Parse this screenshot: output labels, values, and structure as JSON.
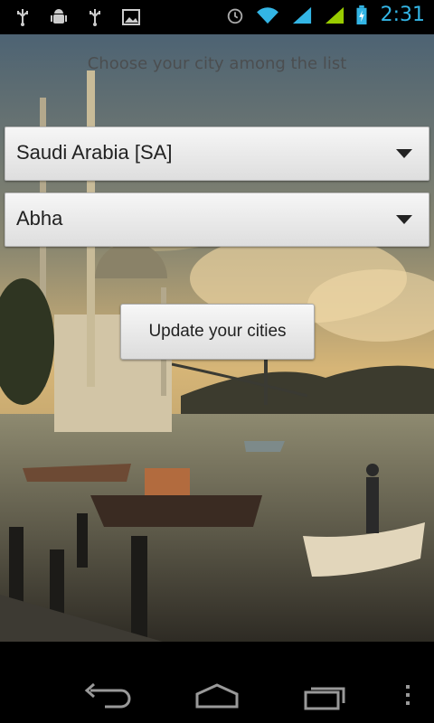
{
  "status_bar": {
    "time": "2:31",
    "left_icons": [
      "usb-icon",
      "android-debug-icon",
      "usb-icon",
      "image-icon"
    ],
    "right_icons": [
      "alarm-icon",
      "wifi-icon",
      "signal-icon",
      "signal-icon",
      "battery-charging-icon"
    ],
    "accent_color": "#33b5e5"
  },
  "screen": {
    "prompt": "Choose your city among the list",
    "country_select": {
      "selected": "Saudi Arabia [SA]"
    },
    "city_select": {
      "selected": "Abha"
    },
    "update_button": "Update your cities"
  },
  "nav_bar": {
    "buttons": [
      "back-icon",
      "home-icon",
      "recent-apps-icon",
      "menu-icon"
    ]
  }
}
